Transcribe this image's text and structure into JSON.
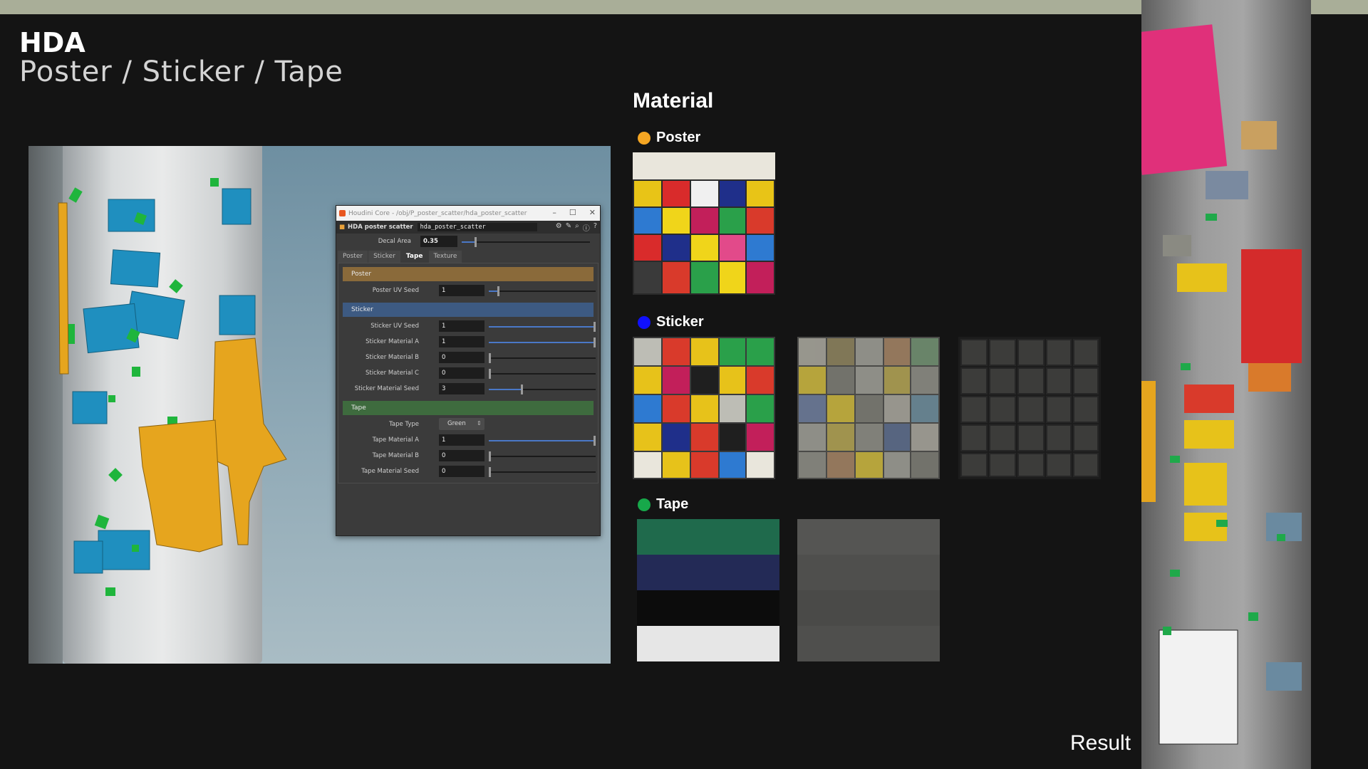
{
  "header": {
    "title": "HDA",
    "subtitle": "Poster / Sticker / Tape"
  },
  "houdini": {
    "window_title": "Houdini Core - /obj/P_poster_scatter/hda_poster_scatter",
    "node_type": "HDA poster scatter",
    "node_name": "hda_poster_scatter",
    "decal_area": {
      "label": "Decal Area",
      "value": "0.35",
      "fraction": 0.1
    },
    "tabs": [
      "Poster",
      "Sticker",
      "Tape",
      "Texture"
    ],
    "active_tab": "Tape",
    "folders": {
      "poster": "Poster",
      "sticker": "Sticker",
      "tape": "Tape"
    },
    "params": [
      {
        "label": "Poster UV Seed",
        "value": "1",
        "fraction": 0.08
      },
      {
        "label": "Sticker UV Seed",
        "value": "1",
        "fraction": 1.0
      },
      {
        "label": "Sticker Material A",
        "value": "1",
        "fraction": 1.0
      },
      {
        "label": "Sticker Material B",
        "value": "0",
        "fraction": 0.0
      },
      {
        "label": "Sticker Material C",
        "value": "0",
        "fraction": 0.0
      },
      {
        "label": "Sticker Material Seed",
        "value": "3",
        "fraction": 0.3
      },
      {
        "label": "Tape Type",
        "value": "Green"
      },
      {
        "label": "Tape Material A",
        "value": "1",
        "fraction": 1.0
      },
      {
        "label": "Tape Material B",
        "value": "0",
        "fraction": 0.0
      },
      {
        "label": "Tape Material Seed",
        "value": "0",
        "fraction": 0.0
      }
    ]
  },
  "material": {
    "heading": "Material",
    "poster": {
      "label": "Poster",
      "color": "#f5a623"
    },
    "sticker": {
      "label": "Sticker",
      "color": "#1010ff"
    },
    "tape": {
      "label": "Tape",
      "color": "#17a84a"
    }
  },
  "result_label": "Result",
  "colors": {
    "background": "#141414",
    "topbar": "#a9ae98",
    "poster_yellow": "#e6a51e",
    "sticker_blue": "#1f8fbf",
    "tape_green": "#1fb53c"
  }
}
